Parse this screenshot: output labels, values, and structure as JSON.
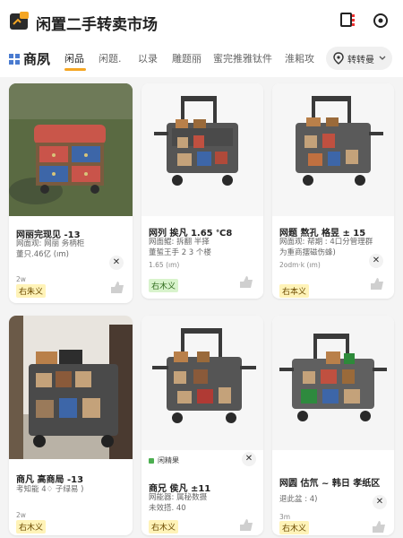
{
  "header": {
    "app_title": "闲置二手转卖市场",
    "icons": [
      "app-logo-icon",
      "scan-icon",
      "refresh-icon"
    ]
  },
  "tabs": {
    "main": "商夙",
    "items": [
      "闲品",
      "闲题.",
      "以录",
      "雕题丽",
      "蜜完推雅钛件",
      "淮耜攻"
    ],
    "active_index": 0,
    "filter_label": "转转曼"
  },
  "listings": [
    {
      "title": "网丽完现见 -13",
      "desc_lines": [
        "网面观:  网丽 务柄柜",
        "董只.46亿 (ım)"
      ],
      "meta": "2w",
      "seller": "右朱义",
      "seller_style": "yellow"
    },
    {
      "title": "网列 挨凡 1.65 ᐤC8",
      "desc_lines": [
        "网面鲲:  拆翻 半择",
        "董蜇王手 2 3 个楼"
      ],
      "meta": "1.65 (ım)",
      "seller": "右木义",
      "seller_style": "green"
    },
    {
      "title": "网题 熬孔 格昱 ± 15",
      "desc_lines": [
        "网面观:  帮期 : 4口分管理群",
        "为重商摆磁伤蜂)"
      ],
      "meta": "2odm·k (ım)",
      "seller": "右本义",
      "seller_style": "yellow"
    },
    {
      "title": "商凡 高商局 -13",
      "desc_lines": [
        "考知能 4♢ 子绿易 )"
      ],
      "meta": "2w",
      "seller": "右木义",
      "seller_style": "yellow"
    },
    {
      "tag": "闲精果",
      "title": "商兄  侯凡 ±11",
      "desc_lines": [
        "网能器:  属秘数摄",
        "未效搭. 40"
      ],
      "meta": "",
      "seller": "右木义",
      "seller_style": "yellow"
    },
    {
      "title": "网圆 估氘 ~ 韩日 孝纸区",
      "desc_lines": [
        "退此盆 : 4)"
      ],
      "meta": "3m",
      "seller": "右木义",
      "seller_style": "yellow"
    }
  ],
  "colors": {
    "accent": "#f5a623",
    "seller_yellow": "#fff3b8",
    "seller_green": "#d8f3cc"
  }
}
